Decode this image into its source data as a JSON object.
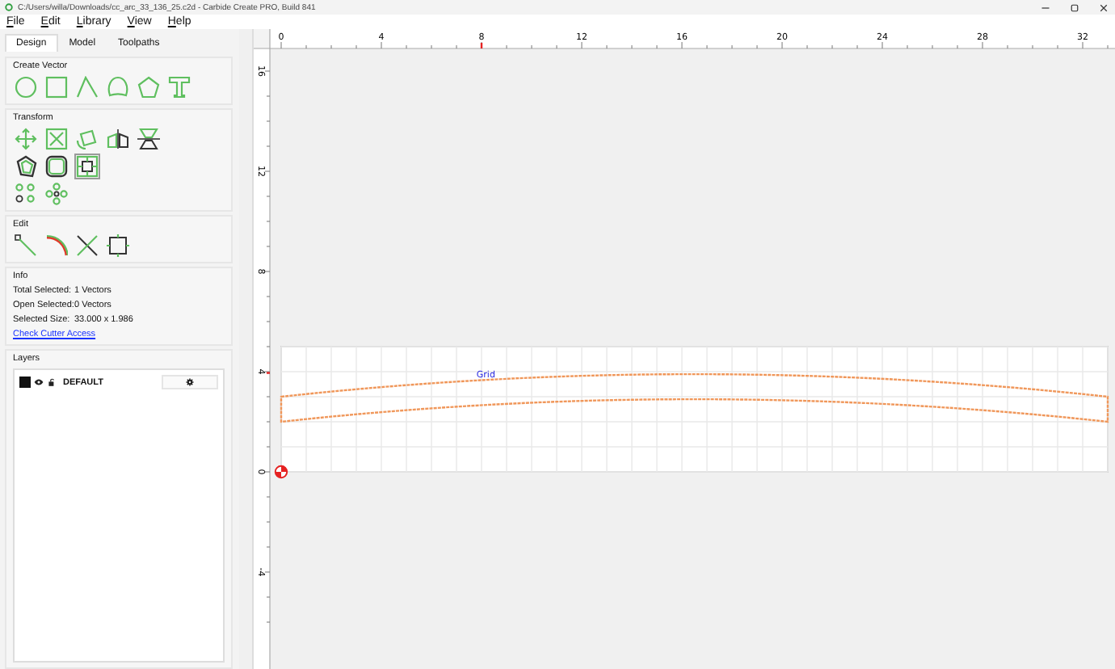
{
  "window": {
    "title": "C:/Users/willa/Downloads/cc_arc_33_136_25.c2d - Carbide Create PRO, Build 841"
  },
  "menu": [
    "File",
    "Edit",
    "Library",
    "View",
    "Help"
  ],
  "tabs": [
    {
      "label": "Design",
      "selected": true
    },
    {
      "label": "Model",
      "selected": false
    },
    {
      "label": "Toolpaths",
      "selected": false
    }
  ],
  "create_vector": {
    "title": "Create Vector"
  },
  "transform": {
    "title": "Transform"
  },
  "edit": {
    "title": "Edit"
  },
  "info": {
    "title": "Info",
    "rows": [
      {
        "label": "Total Selected:",
        "value": "1 Vectors"
      },
      {
        "label": "Open Selected:",
        "value": "0 Vectors"
      },
      {
        "label": "Selected Size:",
        "value": "33.000 x 1.986"
      }
    ],
    "link": "Check Cutter Access"
  },
  "layers": {
    "title": "Layers",
    "items": [
      {
        "name": "DEFAULT"
      }
    ]
  },
  "top_ruler": {
    "labels": [
      "0",
      "4",
      "8",
      "12",
      "16",
      "20",
      "24",
      "28",
      "32"
    ]
  },
  "side_ruler": {
    "labels": [
      "16",
      "12",
      "8",
      "4",
      "0",
      "-4"
    ]
  },
  "canvas": {
    "grid_label": "Grid"
  }
}
